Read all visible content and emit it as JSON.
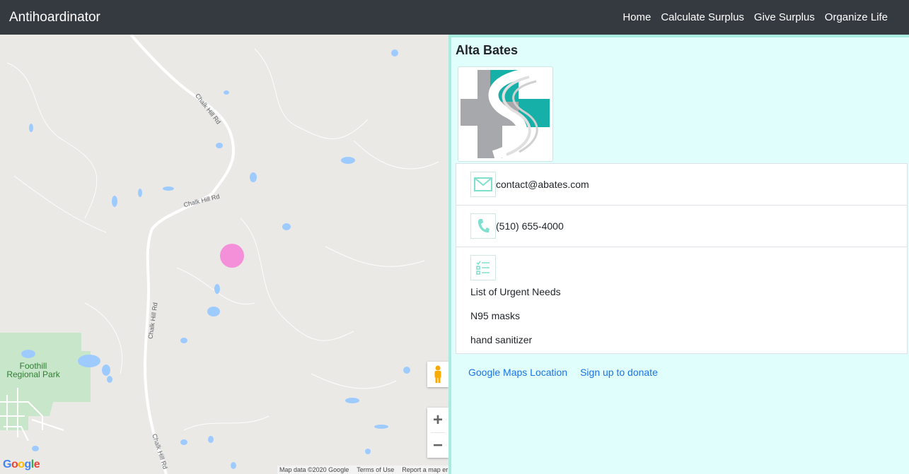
{
  "navbar": {
    "brand": "Antihoardinator",
    "items": [
      "Home",
      "Calculate Surplus",
      "Give Surplus",
      "Organize Life"
    ]
  },
  "map": {
    "roads": [
      "Chalk Hill Rd",
      "Chalk Hill Rd",
      "Chalk Hill Rd",
      "Chalk Hill Rd"
    ],
    "park": "Foothill Regional Park",
    "logo": "Google",
    "footer": [
      "Map data ©2020 Google",
      "Terms of Use",
      "Report a map er"
    ],
    "zoom_in": "+",
    "zoom_out": "−",
    "marker_color": "#f48fda",
    "water_color": "#9ecbff"
  },
  "info": {
    "title": "Alta Bates",
    "email": "contact@abates.com",
    "phone": "(510) 655-4000",
    "needs_title": "List of Urgent Needs",
    "needs": [
      "N95 masks",
      "hand sanitizer"
    ],
    "links": {
      "maps": "Google Maps Location",
      "donate": "Sign up to donate"
    },
    "accent": "#a9ecdf",
    "panel_bg": "#e0fefb"
  }
}
